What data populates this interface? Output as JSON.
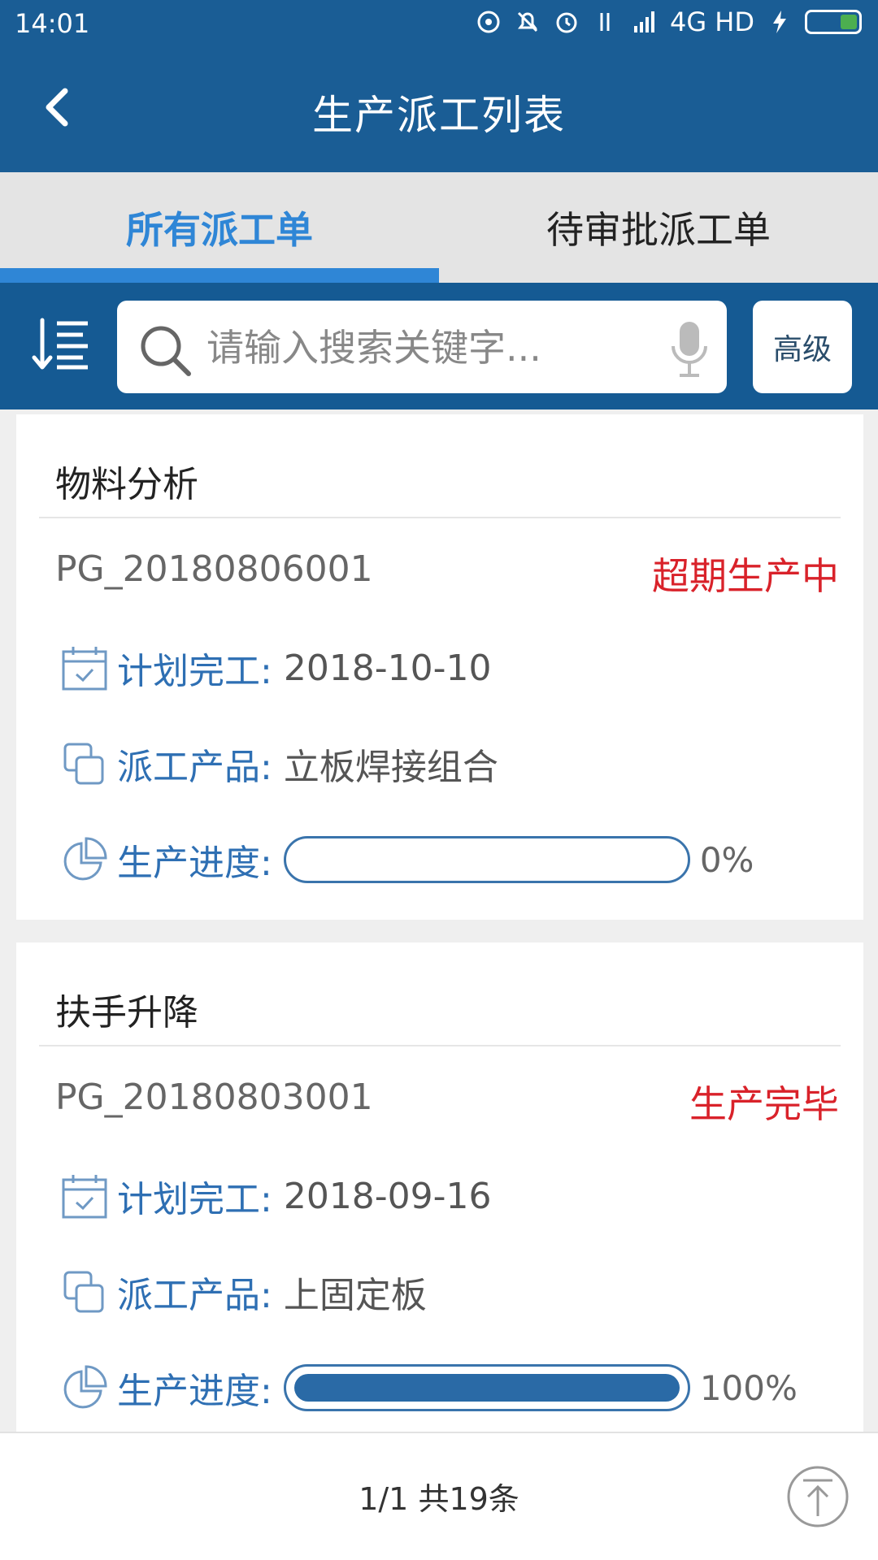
{
  "status_bar": {
    "time": "14:01",
    "network": "4G HD"
  },
  "header": {
    "title": "生产派工列表"
  },
  "tabs": [
    {
      "label": "所有派工单",
      "active": true
    },
    {
      "label": "待审批派工单",
      "active": false
    }
  ],
  "search": {
    "placeholder": "请输入搜索关键字...",
    "advanced_label": "高级"
  },
  "cards": [
    {
      "title": "物料分析",
      "code": "PG_20180806001",
      "status": "超期生产中",
      "plan_label": "计划完工:",
      "plan_value": "2018-10-10",
      "product_label": "派工产品:",
      "product_value": "立板焊接组合",
      "progress_label": "生产进度:",
      "progress_value": 0,
      "progress_text": "0%"
    },
    {
      "title": "扶手升降",
      "code": "PG_20180803001",
      "status": "生产完毕",
      "plan_label": "计划完工:",
      "plan_value": "2018-09-16",
      "product_label": "派工产品:",
      "product_value": "上固定板",
      "progress_label": "生产进度:",
      "progress_value": 1.0,
      "progress_text": "100%"
    }
  ],
  "footer": {
    "pager": "1/1 共19条"
  },
  "colors": {
    "primary": "#1a5d95",
    "accent": "#2f86d6",
    "status_red": "#d9222a"
  },
  "icons": [
    "back-arrow-icon",
    "sort-icon",
    "search-icon",
    "mic-icon",
    "calendar-icon",
    "copy-icon",
    "pie-chart-icon",
    "back-to-top-icon"
  ]
}
